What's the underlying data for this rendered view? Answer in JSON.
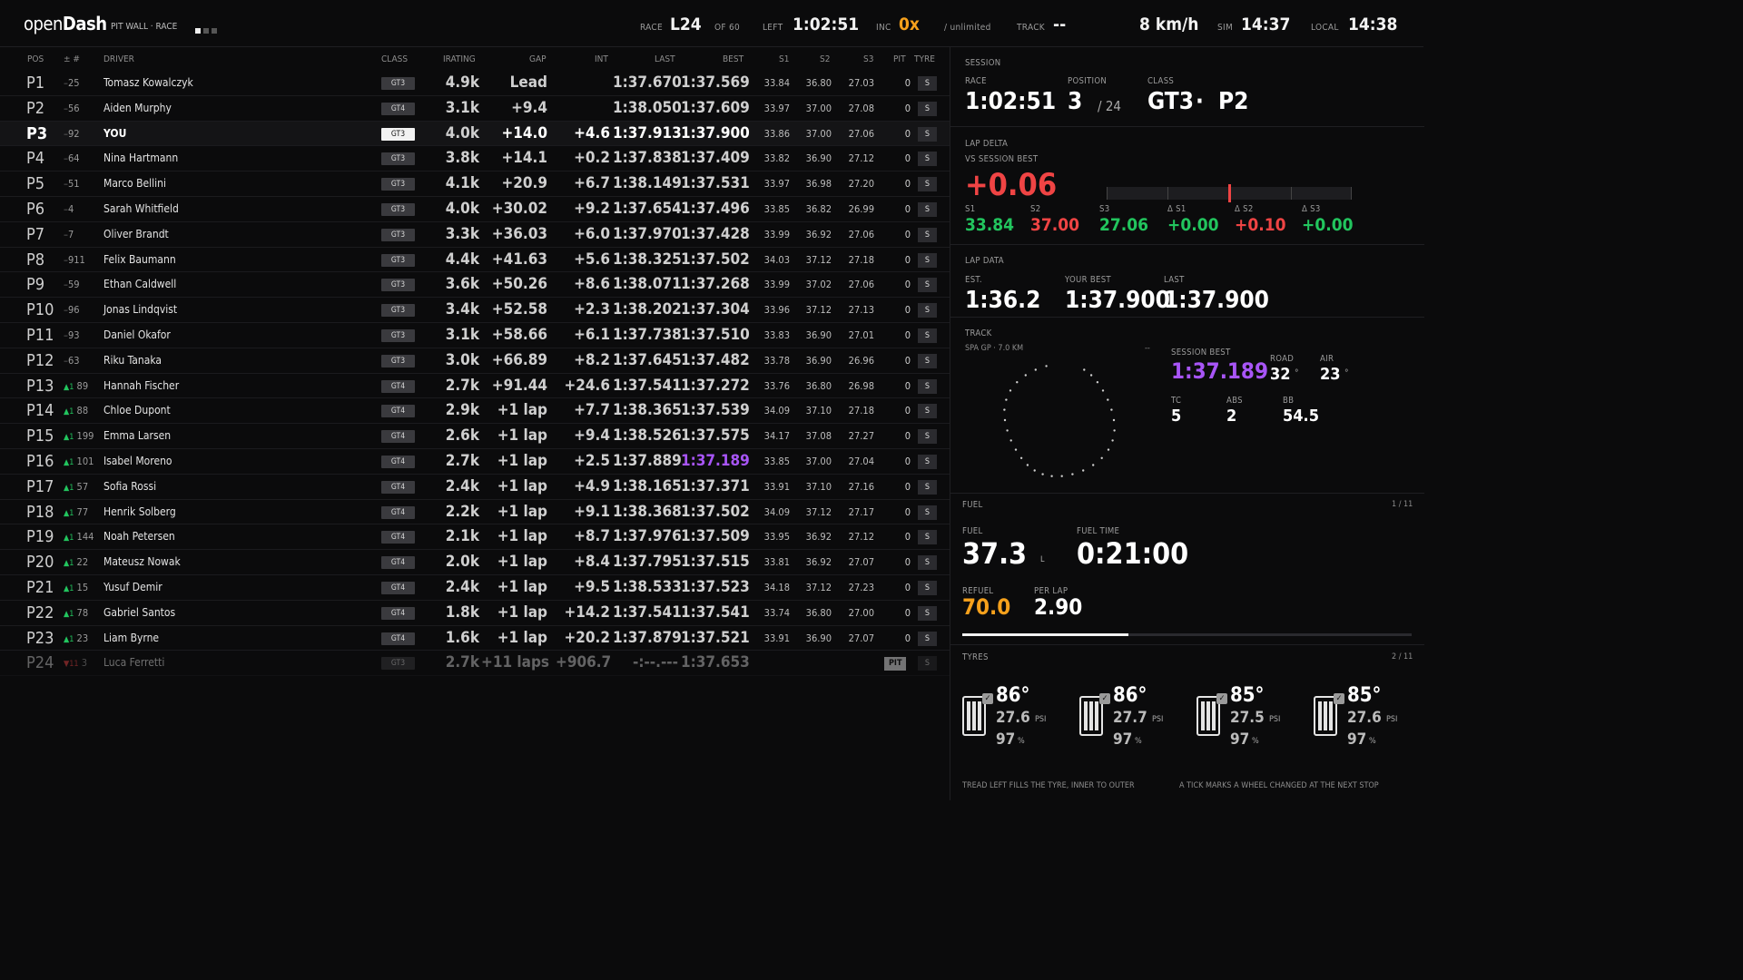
{
  "header": {
    "logo_light": "open",
    "logo_bold": "Dash",
    "mode": "PIT WALL · RACE",
    "race_label": "RACE",
    "race_value": "L24",
    "of_label": "OF 60",
    "left_label": "LEFT",
    "left_value": "1:02:51",
    "inc_label": "INC",
    "inc_value": "0x",
    "inc_sub": "/ unlimited",
    "track_label": "TRACK",
    "track_value": "--",
    "speed": "8 km/h",
    "sim_label": "SIM",
    "sim_value": "14:37",
    "local_label": "LOCAL",
    "local_value": "14:38",
    "page_dots": 3,
    "page_dot_active": 1
  },
  "table": {
    "headers": {
      "pos": "POS",
      "num": "± #",
      "driver": "DRIVER",
      "class": "CLASS",
      "irating": "IRATING",
      "gap": "GAP",
      "int": "INT",
      "last": "LAST",
      "best": "BEST",
      "s1": "S1",
      "s2": "S2",
      "s3": "S3",
      "pit": "PIT",
      "tyre": "TYRE"
    },
    "rows": [
      {
        "pos": "P1",
        "change": "",
        "change_dir": "",
        "num": "25",
        "driver": "Tomasz Kowalczyk",
        "class": "GT3",
        "irating": "4.9k",
        "gap": "Lead",
        "int": "",
        "last": "1:37.670",
        "best": "1:37.569",
        "s1": "33.84",
        "s2": "36.80",
        "s3": "27.03",
        "pit": "0",
        "tyre": "S"
      },
      {
        "pos": "P2",
        "change": "",
        "change_dir": "",
        "num": "56",
        "driver": "Aiden Murphy",
        "class": "GT4",
        "irating": "3.1k",
        "gap": "+9.4",
        "int": "",
        "last": "1:38.050",
        "best": "1:37.609",
        "s1": "33.97",
        "s2": "37.00",
        "s3": "27.08",
        "pit": "0",
        "tyre": "S"
      },
      {
        "pos": "P3",
        "change": "",
        "change_dir": "",
        "num": "92",
        "driver": "YOU",
        "class": "GT3",
        "irating": "4.0k",
        "gap": "+14.0",
        "int": "+4.6",
        "last": "1:37.913",
        "best": "1:37.900",
        "s1": "33.86",
        "s2": "37.00",
        "s3": "27.06",
        "pit": "0",
        "tyre": "S",
        "you": true
      },
      {
        "pos": "P4",
        "change": "",
        "change_dir": "",
        "num": "64",
        "driver": "Nina Hartmann",
        "class": "GT3",
        "irating": "3.8k",
        "gap": "+14.1",
        "int": "+0.2",
        "last": "1:37.838",
        "best": "1:37.409",
        "s1": "33.82",
        "s2": "36.90",
        "s3": "27.12",
        "pit": "0",
        "tyre": "S"
      },
      {
        "pos": "P5",
        "change": "",
        "change_dir": "",
        "num": "51",
        "driver": "Marco Bellini",
        "class": "GT3",
        "irating": "4.1k",
        "gap": "+20.9",
        "int": "+6.7",
        "last": "1:38.149",
        "best": "1:37.531",
        "s1": "33.97",
        "s2": "36.98",
        "s3": "27.20",
        "pit": "0",
        "tyre": "S"
      },
      {
        "pos": "P6",
        "change": "",
        "change_dir": "",
        "num": "4",
        "driver": "Sarah Whitfield",
        "class": "GT3",
        "irating": "4.0k",
        "gap": "+30.02",
        "int": "+9.2",
        "last": "1:37.654",
        "best": "1:37.496",
        "s1": "33.85",
        "s2": "36.82",
        "s3": "26.99",
        "pit": "0",
        "tyre": "S"
      },
      {
        "pos": "P7",
        "change": "",
        "change_dir": "",
        "num": "7",
        "driver": "Oliver Brandt",
        "class": "GT3",
        "irating": "3.3k",
        "gap": "+36.03",
        "int": "+6.0",
        "last": "1:37.970",
        "best": "1:37.428",
        "s1": "33.99",
        "s2": "36.92",
        "s3": "27.06",
        "pit": "0",
        "tyre": "S"
      },
      {
        "pos": "P8",
        "change": "",
        "change_dir": "",
        "num": "911",
        "driver": "Felix Baumann",
        "class": "GT3",
        "irating": "4.4k",
        "gap": "+41.63",
        "int": "+5.6",
        "last": "1:38.325",
        "best": "1:37.502",
        "s1": "34.03",
        "s2": "37.12",
        "s3": "27.18",
        "pit": "0",
        "tyre": "S"
      },
      {
        "pos": "P9",
        "change": "",
        "change_dir": "",
        "num": "59",
        "driver": "Ethan Caldwell",
        "class": "GT3",
        "irating": "3.6k",
        "gap": "+50.26",
        "int": "+8.6",
        "last": "1:38.071",
        "best": "1:37.268",
        "s1": "33.99",
        "s2": "37.02",
        "s3": "27.06",
        "pit": "0",
        "tyre": "S"
      },
      {
        "pos": "P10",
        "change": "",
        "change_dir": "",
        "num": "96",
        "driver": "Jonas Lindqvist",
        "class": "GT3",
        "irating": "3.4k",
        "gap": "+52.58",
        "int": "+2.3",
        "last": "1:38.202",
        "best": "1:37.304",
        "s1": "33.96",
        "s2": "37.12",
        "s3": "27.13",
        "pit": "0",
        "tyre": "S"
      },
      {
        "pos": "P11",
        "change": "",
        "change_dir": "",
        "num": "93",
        "driver": "Daniel Okafor",
        "class": "GT3",
        "irating": "3.1k",
        "gap": "+58.66",
        "int": "+6.1",
        "last": "1:37.738",
        "best": "1:37.510",
        "s1": "33.83",
        "s2": "36.90",
        "s3": "27.01",
        "pit": "0",
        "tyre": "S"
      },
      {
        "pos": "P12",
        "change": "",
        "change_dir": "",
        "num": "63",
        "driver": "Riku Tanaka",
        "class": "GT3",
        "irating": "3.0k",
        "gap": "+66.89",
        "int": "+8.2",
        "last": "1:37.645",
        "best": "1:37.482",
        "s1": "33.78",
        "s2": "36.90",
        "s3": "26.96",
        "pit": "0",
        "tyre": "S"
      },
      {
        "pos": "P13",
        "change": "▲1",
        "change_dir": "up",
        "num": "89",
        "driver": "Hannah Fischer",
        "class": "GT4",
        "irating": "2.7k",
        "gap": "+91.44",
        "int": "+24.6",
        "last": "1:37.541",
        "best": "1:37.272",
        "s1": "33.76",
        "s2": "36.80",
        "s3": "26.98",
        "pit": "0",
        "tyre": "S"
      },
      {
        "pos": "P14",
        "change": "▲1",
        "change_dir": "up",
        "num": "88",
        "driver": "Chloe Dupont",
        "class": "GT4",
        "irating": "2.9k",
        "gap": "+1 lap",
        "int": "+7.7",
        "last": "1:38.365",
        "best": "1:37.539",
        "s1": "34.09",
        "s2": "37.10",
        "s3": "27.18",
        "pit": "0",
        "tyre": "S"
      },
      {
        "pos": "P15",
        "change": "▲1",
        "change_dir": "up",
        "num": "199",
        "driver": "Emma Larsen",
        "class": "GT4",
        "irating": "2.6k",
        "gap": "+1 lap",
        "int": "+9.4",
        "last": "1:38.526",
        "best": "1:37.575",
        "s1": "34.17",
        "s2": "37.08",
        "s3": "27.27",
        "pit": "0",
        "tyre": "S"
      },
      {
        "pos": "P16",
        "change": "▲1",
        "change_dir": "up",
        "num": "101",
        "driver": "Isabel Moreno",
        "class": "GT4",
        "irating": "2.7k",
        "gap": "+1 lap",
        "int": "+2.5",
        "last": "1:37.889",
        "best": "1:37.189",
        "s1": "33.85",
        "s2": "37.00",
        "s3": "27.04",
        "pit": "0",
        "tyre": "S",
        "best_purple": true
      },
      {
        "pos": "P17",
        "change": "▲1",
        "change_dir": "up",
        "num": "57",
        "driver": "Sofia Rossi",
        "class": "GT4",
        "irating": "2.4k",
        "gap": "+1 lap",
        "int": "+4.9",
        "last": "1:38.165",
        "best": "1:37.371",
        "s1": "33.91",
        "s2": "37.10",
        "s3": "27.16",
        "pit": "0",
        "tyre": "S"
      },
      {
        "pos": "P18",
        "change": "▲1",
        "change_dir": "up",
        "num": "77",
        "driver": "Henrik Solberg",
        "class": "GT4",
        "irating": "2.2k",
        "gap": "+1 lap",
        "int": "+9.1",
        "last": "1:38.368",
        "best": "1:37.502",
        "s1": "34.09",
        "s2": "37.12",
        "s3": "27.17",
        "pit": "0",
        "tyre": "S"
      },
      {
        "pos": "P19",
        "change": "▲1",
        "change_dir": "up",
        "num": "144",
        "driver": "Noah Petersen",
        "class": "GT4",
        "irating": "2.1k",
        "gap": "+1 lap",
        "int": "+8.7",
        "last": "1:37.976",
        "best": "1:37.509",
        "s1": "33.95",
        "s2": "36.92",
        "s3": "27.12",
        "pit": "0",
        "tyre": "S"
      },
      {
        "pos": "P20",
        "change": "▲1",
        "change_dir": "up",
        "num": "22",
        "driver": "Mateusz Nowak",
        "class": "GT4",
        "irating": "2.0k",
        "gap": "+1 lap",
        "int": "+8.4",
        "last": "1:37.795",
        "best": "1:37.515",
        "s1": "33.81",
        "s2": "36.92",
        "s3": "27.07",
        "pit": "0",
        "tyre": "S"
      },
      {
        "pos": "P21",
        "change": "▲1",
        "change_dir": "up",
        "num": "15",
        "driver": "Yusuf Demir",
        "class": "GT4",
        "irating": "2.4k",
        "gap": "+1 lap",
        "int": "+9.5",
        "last": "1:38.533",
        "best": "1:37.523",
        "s1": "34.18",
        "s2": "37.12",
        "s3": "27.23",
        "pit": "0",
        "tyre": "S"
      },
      {
        "pos": "P22",
        "change": "▲1",
        "change_dir": "up",
        "num": "78",
        "driver": "Gabriel Santos",
        "class": "GT4",
        "irating": "1.8k",
        "gap": "+1 lap",
        "int": "+14.2",
        "last": "1:37.541",
        "best": "1:37.541",
        "s1": "33.74",
        "s2": "36.80",
        "s3": "27.00",
        "pit": "0",
        "tyre": "S"
      },
      {
        "pos": "P23",
        "change": "▲1",
        "change_dir": "up",
        "num": "23",
        "driver": "Liam Byrne",
        "class": "GT4",
        "irating": "1.6k",
        "gap": "+1 lap",
        "int": "+20.2",
        "last": "1:37.879",
        "best": "1:37.521",
        "s1": "33.91",
        "s2": "36.90",
        "s3": "27.07",
        "pit": "0",
        "tyre": "S"
      },
      {
        "pos": "P24",
        "change": "▼11",
        "change_dir": "down",
        "num": "3",
        "driver": "Luca Ferretti",
        "class": "GT3",
        "irating": "2.7k",
        "gap": "+11 laps",
        "int": "+906.7",
        "last": "-:--.---",
        "best": "1:37.653",
        "s1": "",
        "s2": "",
        "s3": "",
        "pit": "PIT",
        "tyre": "S",
        "out": true
      }
    ]
  },
  "session": {
    "title": "SESSION",
    "race_label": "RACE",
    "race_value": "1:02:51",
    "position_label": "POSITION",
    "position_value": "3",
    "position_total": "/ 24",
    "class_label": "CLASS",
    "class_value": "GT3",
    "class_sep": "·",
    "class_pos": "P2"
  },
  "lap_delta": {
    "title": "LAP DELTA",
    "subtitle": "VS SESSION BEST",
    "value": "+0.06",
    "marker_fraction": 0.5,
    "sectors": [
      {
        "label": "S1",
        "value": "33.84",
        "color": "green"
      },
      {
        "label": "S2",
        "value": "37.00",
        "color": "red"
      },
      {
        "label": "S3",
        "value": "27.06",
        "color": "green"
      },
      {
        "label": "Δ S1",
        "value": "+0.00",
        "color": "green"
      },
      {
        "label": "Δ S2",
        "value": "+0.10",
        "color": "red"
      },
      {
        "label": "Δ S3",
        "value": "+0.00",
        "color": "green"
      }
    ]
  },
  "lap_data": {
    "title": "LAP DATA",
    "est_label": "EST.",
    "est_value": "1:36.2",
    "best_label": "YOUR BEST",
    "best_value": "1:37.900",
    "last_label": "LAST",
    "last_value": "1:37.900"
  },
  "track": {
    "title": "TRACK",
    "name": "SPA GP · 7.0 KM",
    "dash": "--",
    "session_best_label": "SESSION BEST",
    "session_best_value": "1:37.189",
    "road_label": "ROAD",
    "road_value": "32",
    "road_unit": "°",
    "air_label": "AIR",
    "air_value": "23",
    "air_unit": "°",
    "tc_label": "TC",
    "tc_value": "5",
    "abs_label": "ABS",
    "abs_value": "2",
    "bb_label": "BB",
    "bb_value": "54.5"
  },
  "fuel": {
    "title": "FUEL",
    "page": "1 / 11",
    "fuel_label": "FUEL",
    "fuel_value": "37.3",
    "fuel_unit": "L",
    "time_label": "FUEL TIME",
    "time_value": "0:21:00",
    "refuel_label": "REFUEL",
    "refuel_value": "70.0",
    "perlap_label": "PER LAP",
    "perlap_value": "2.90",
    "level_fraction": 0.37
  },
  "tyres": {
    "title": "TYRES",
    "page": "2 / 11",
    "items": [
      {
        "temp": "86°",
        "psi": "27.6",
        "psi_unit": "PSI",
        "wear": "97",
        "wear_unit": "%"
      },
      {
        "temp": "86°",
        "psi": "27.7",
        "psi_unit": "PSI",
        "wear": "97",
        "wear_unit": "%"
      },
      {
        "temp": "85°",
        "psi": "27.5",
        "psi_unit": "PSI",
        "wear": "97",
        "wear_unit": "%"
      },
      {
        "temp": "85°",
        "psi": "27.6",
        "psi_unit": "PSI",
        "wear": "97",
        "wear_unit": "%"
      }
    ],
    "note_left": "TREAD LEFT FILLS THE TYRE, INNER TO OUTER",
    "note_right": "A TICK MARKS A WHEEL CHANGED AT THE NEXT STOP"
  },
  "colors": {
    "green": "#22c55e",
    "red": "#ef4444",
    "purple": "#a855f7",
    "orange": "#f6a11c"
  }
}
